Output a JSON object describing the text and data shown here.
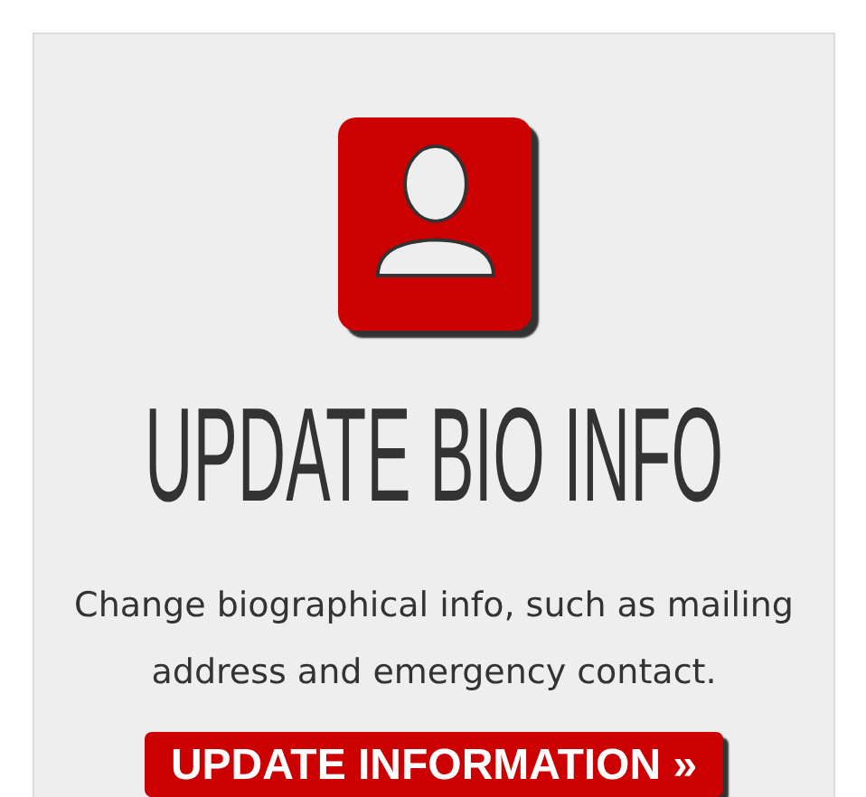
{
  "card": {
    "title": "UPDATE BIO INFO",
    "description": "Change biographical info, such as mailing address and emergency contact.",
    "button": "UPDATE INFORMATION »"
  }
}
